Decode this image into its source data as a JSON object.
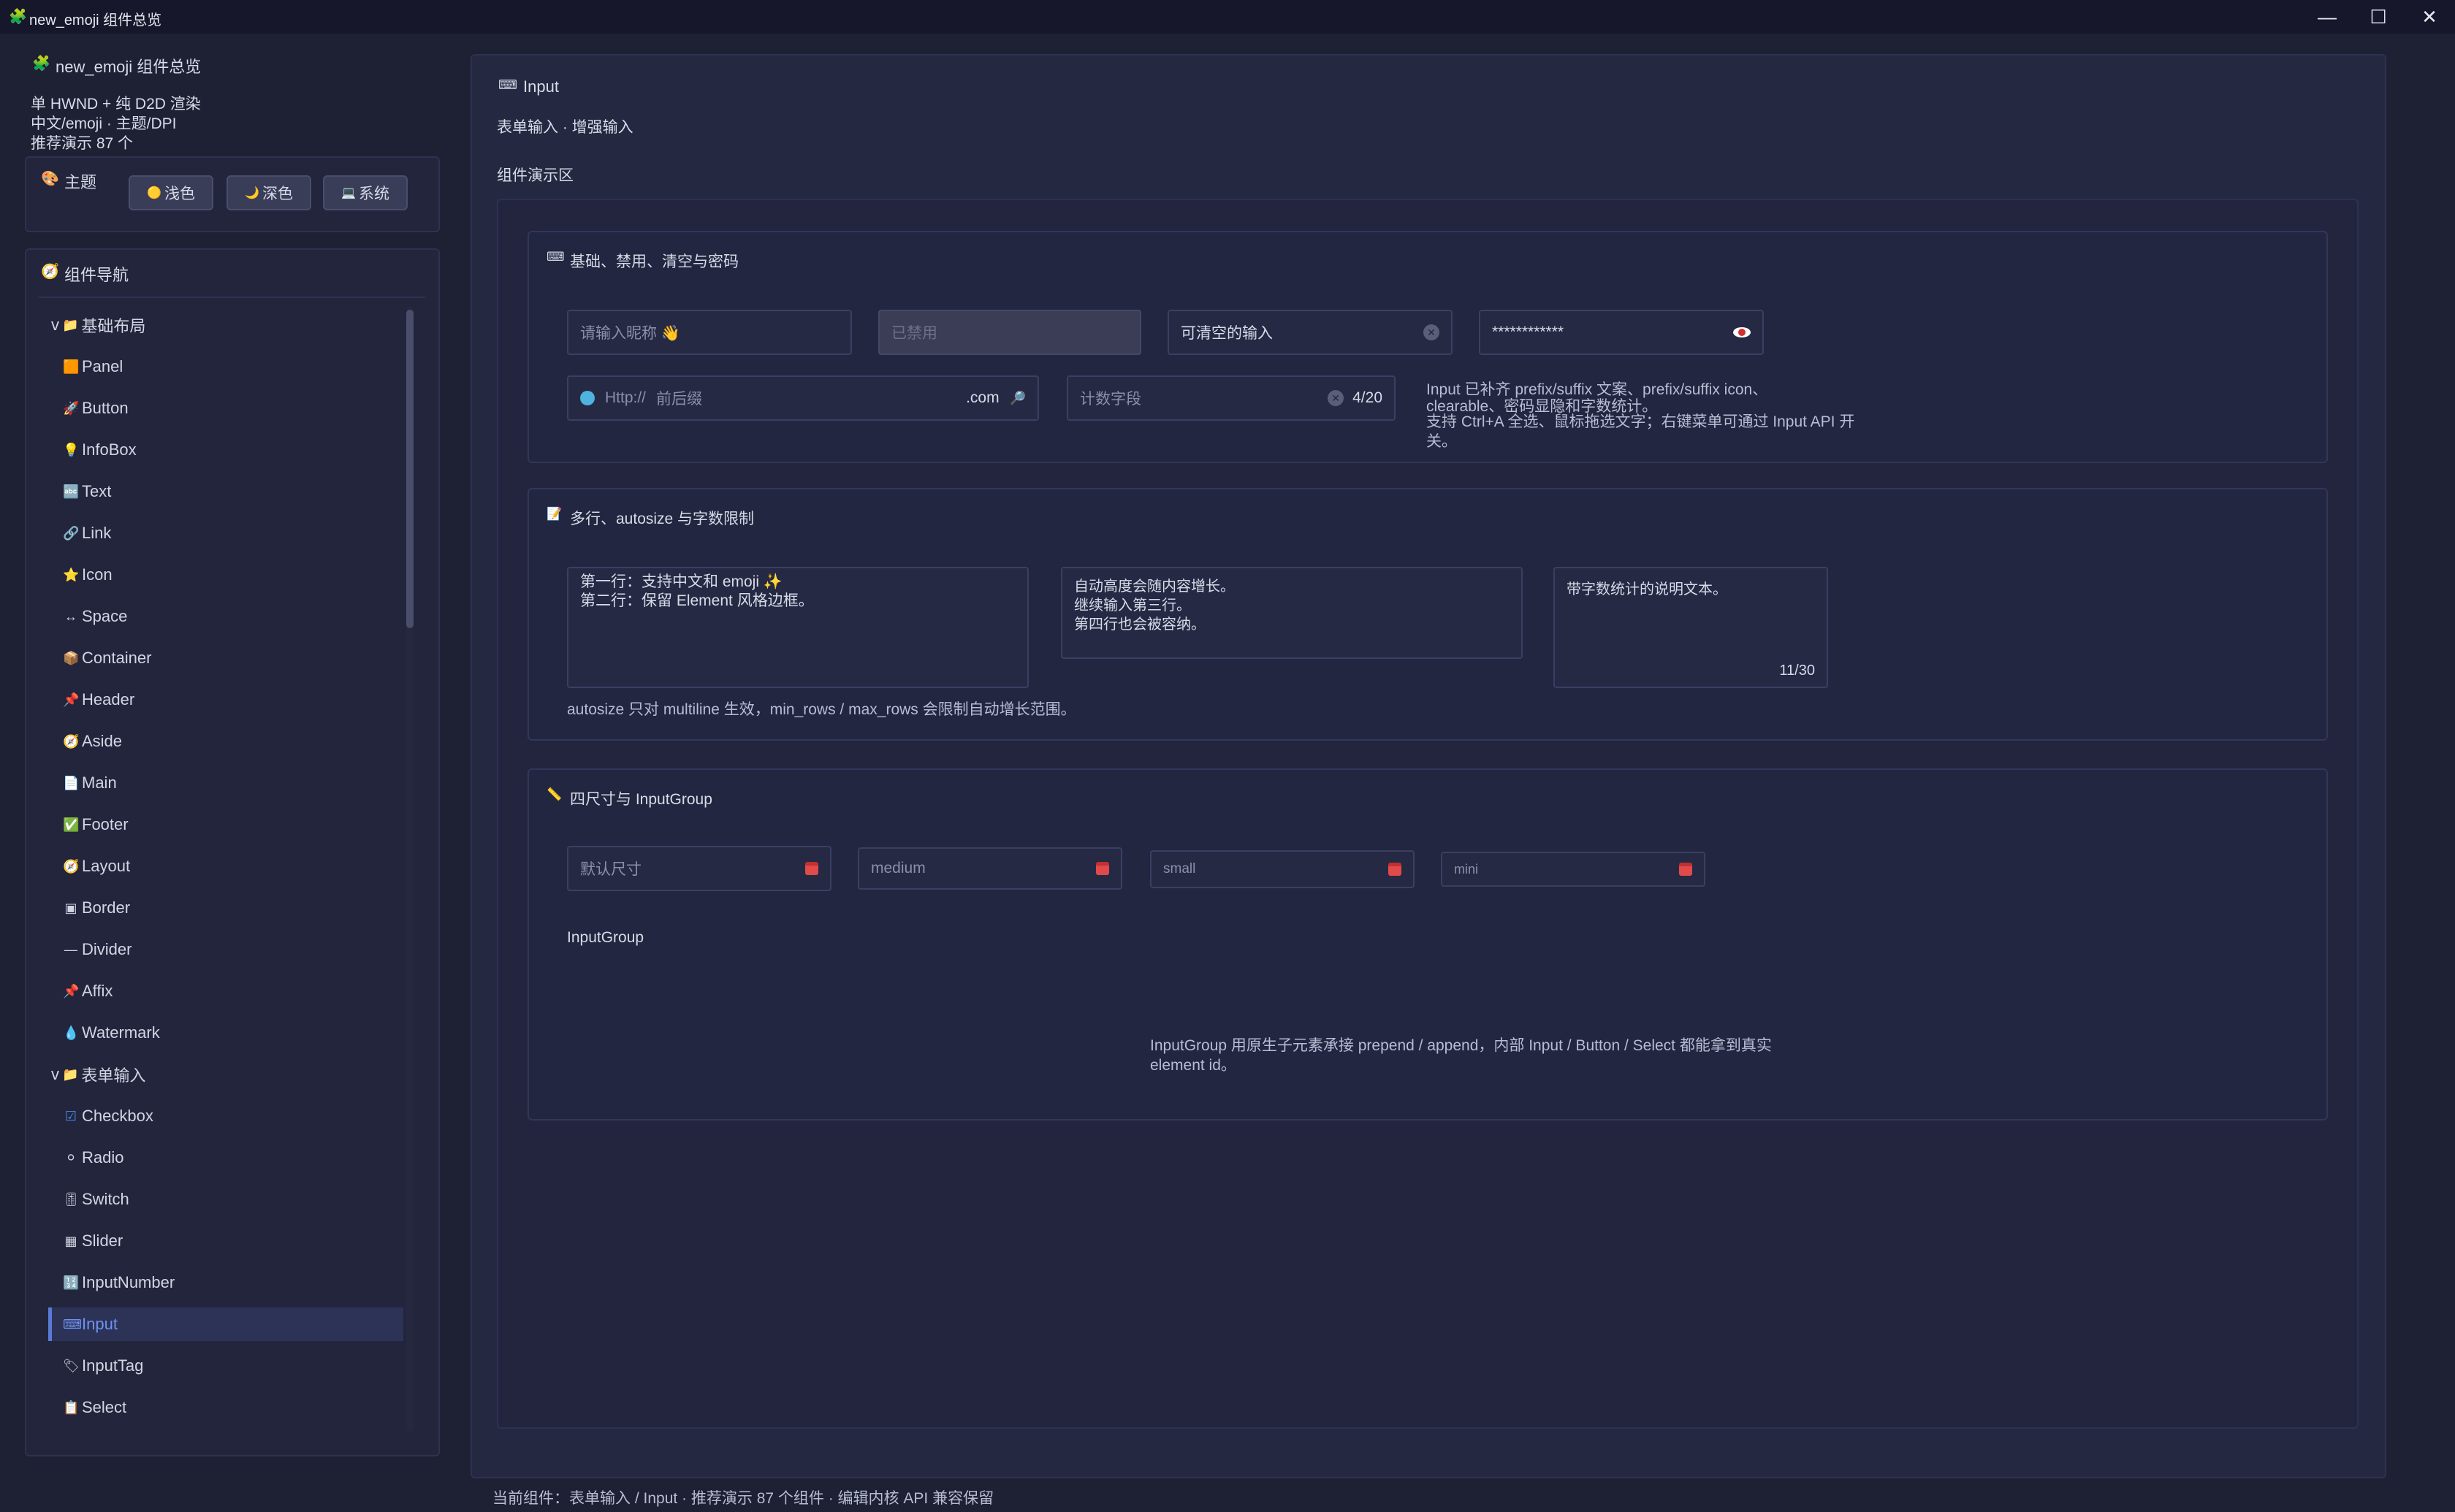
{
  "window": {
    "title": "new_emoji 组件总览",
    "minimize": "—",
    "maximize": "☐",
    "close": "✕"
  },
  "sidebar": {
    "app_title": "new_emoji 组件总览",
    "info_lines": [
      "单 HWND + 纯 D2D 渲染",
      "中文/emoji · 主题/DPI",
      "推荐演示 87 个"
    ],
    "theme": {
      "label": "主题",
      "buttons": [
        {
          "icon": "🟡",
          "label": "浅色"
        },
        {
          "icon": "🌙",
          "label": "深色"
        },
        {
          "icon": "💻",
          "label": "系统"
        }
      ]
    },
    "nav": {
      "title": "组件导航",
      "groups": [
        {
          "label": "基础布局",
          "expander": "v",
          "icon": "📁"
        },
        {
          "label": "表单输入",
          "expander": "v",
          "icon": "📁"
        }
      ],
      "items": [
        {
          "icon": "🟧",
          "label": "Panel"
        },
        {
          "icon": "🚀",
          "label": "Button"
        },
        {
          "icon": "💡",
          "label": "InfoBox"
        },
        {
          "icon": "🔤",
          "label": "Text"
        },
        {
          "icon": "🔗",
          "label": "Link"
        },
        {
          "icon": "⭐",
          "label": "Icon"
        },
        {
          "icon": "↔",
          "label": "Space"
        },
        {
          "icon": "📦",
          "label": "Container"
        },
        {
          "icon": "📌",
          "label": "Header"
        },
        {
          "icon": "🧭",
          "label": "Aside"
        },
        {
          "icon": "📄",
          "label": "Main"
        },
        {
          "icon": "✅",
          "label": "Footer"
        },
        {
          "icon": "🧭",
          "label": "Layout"
        },
        {
          "icon": "▣",
          "label": "Border"
        },
        {
          "icon": "—",
          "label": "Divider"
        },
        {
          "icon": "📌",
          "label": "Affix"
        },
        {
          "icon": "💧",
          "label": "Watermark"
        },
        {
          "icon": "☑",
          "label": "Checkbox"
        },
        {
          "icon": "⚪",
          "label": "Radio"
        },
        {
          "icon": "🎚",
          "label": "Switch"
        },
        {
          "icon": "▦",
          "label": "Slider"
        },
        {
          "icon": "🔢",
          "label": "InputNumber"
        },
        {
          "icon": "⌨",
          "label": "Input"
        },
        {
          "icon": "🏷",
          "label": "InputTag"
        },
        {
          "icon": "📋",
          "label": "Select"
        }
      ]
    }
  },
  "main": {
    "title": "Input",
    "title_icon": "⌨",
    "subtitle": "表单输入 · 增强输入",
    "demo_area_label": "组件演示区",
    "section1": {
      "title": "基础、禁用、清空与密码",
      "icon": "⌨",
      "nickname_placeholder": "请输入昵称 👋",
      "disabled_text": "已禁用",
      "clearable_text": "可清空的输入",
      "password_text": "************",
      "url_prefix": "Http://",
      "url_placeholder": "前后缀",
      "url_suffix": ".com",
      "count_placeholder": "计数字段",
      "count_value": "4/20",
      "desc_lines": [
        "Input 已补齐 prefix/suffix 文案、prefix/suffix icon、",
        "clearable、密码显隐和字数统计。",
        "支持 Ctrl+A 全选、鼠标拖选文字；右键菜单可通过 Input API 开",
        "关。"
      ]
    },
    "section2": {
      "title": "多行、autosize 与字数限制",
      "icon": "📝",
      "textarea1": [
        "第一行：支持中文和 emoji ✨",
        "第二行：保留 Element 风格边框。"
      ],
      "textarea2": [
        "自动高度会随内容增长。",
        "继续输入第三行。",
        "第四行也会被容纳。"
      ],
      "textarea3": "带字数统计的说明文本。",
      "textarea3_count": "11/30",
      "note": "autosize 只对 multiline 生效，min_rows / max_rows 会限制自动增长范围。"
    },
    "section3": {
      "title": "四尺寸与 InputGroup",
      "icon": "📏",
      "sizes": [
        "默认尺寸",
        "medium",
        "small",
        "mini"
      ],
      "group_label": "InputGroup",
      "desc_lines": [
        "InputGroup 用原生子元素承接 prepend / append，内部 Input / Button / Select 都能拿到真实",
        "element id。"
      ]
    },
    "status": "当前组件：表单输入 / Input · 推荐演示 87 个组件 · 编辑内核 API 兼容保留"
  },
  "colors": {
    "accent": "#6f92f0",
    "background": "#1e2034",
    "panel": "#23253c"
  }
}
